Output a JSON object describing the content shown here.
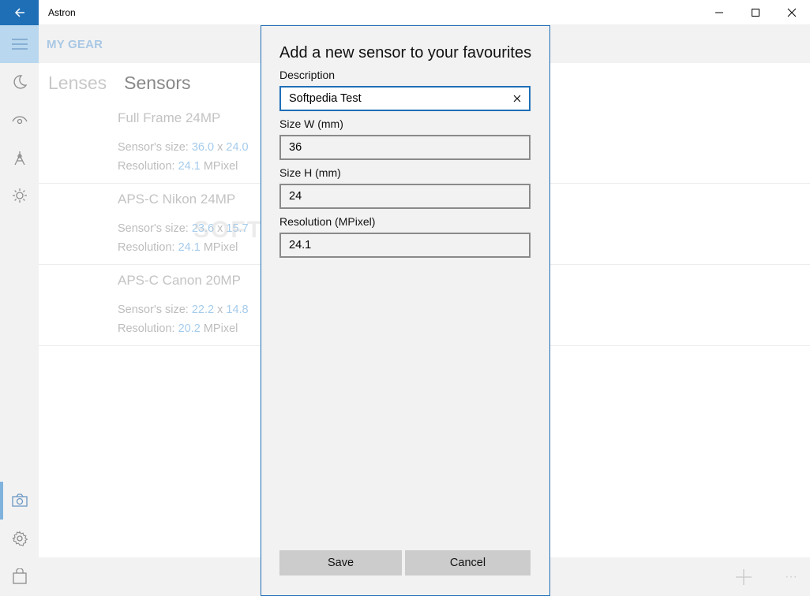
{
  "window": {
    "title": "Astron"
  },
  "header": {
    "title": "MY GEAR"
  },
  "pivot": {
    "tabs": [
      "Lenses",
      "Sensors"
    ],
    "active": "Sensors"
  },
  "sensors": [
    {
      "name": "Full Frame 24MP",
      "size_label": "Sensor's size:",
      "w": "36.0",
      "x": "x",
      "h": "24.0",
      "res_label": "Resolution:",
      "res": "24.1",
      "unit": "MPixel"
    },
    {
      "name": "APS-C Nikon 24MP",
      "size_label": "Sensor's size:",
      "w": "23.6",
      "x": "x",
      "h": "15.7",
      "res_label": "Resolution:",
      "res": "24.1",
      "unit": "MPixel"
    },
    {
      "name": "APS-C Canon 20MP",
      "size_label": "Sensor's size:",
      "w": "22.2",
      "x": "x",
      "h": "14.8",
      "res_label": "Resolution:",
      "res": "20.2",
      "unit": "MPixel"
    }
  ],
  "watermark": "SOFTPEDIA",
  "dialog": {
    "title": "Add a new sensor to your favourites",
    "description_label": "Description",
    "description_value": "Softpedia Test",
    "width_label": "Size W (mm)",
    "width_value": "36",
    "height_label": "Size H (mm)",
    "height_value": "24",
    "resolution_label": "Resolution (MPixel)",
    "resolution_value": "24.1",
    "save_label": "Save",
    "cancel_label": "Cancel"
  },
  "commandbar": {
    "more_label": "···"
  },
  "colors": {
    "accent": "#1f6fb6",
    "value_blue": "#a5cbeb",
    "header_blue": "#a9c8e4"
  },
  "icons": [
    "back-arrow-icon",
    "hamburger-icon",
    "moon-icon",
    "eye-icon",
    "telescope-icon",
    "sun-icon",
    "camera-icon",
    "gear-icon",
    "store-icon",
    "minimize-icon",
    "maximize-icon",
    "close-icon",
    "clear-icon",
    "add-icon"
  ]
}
